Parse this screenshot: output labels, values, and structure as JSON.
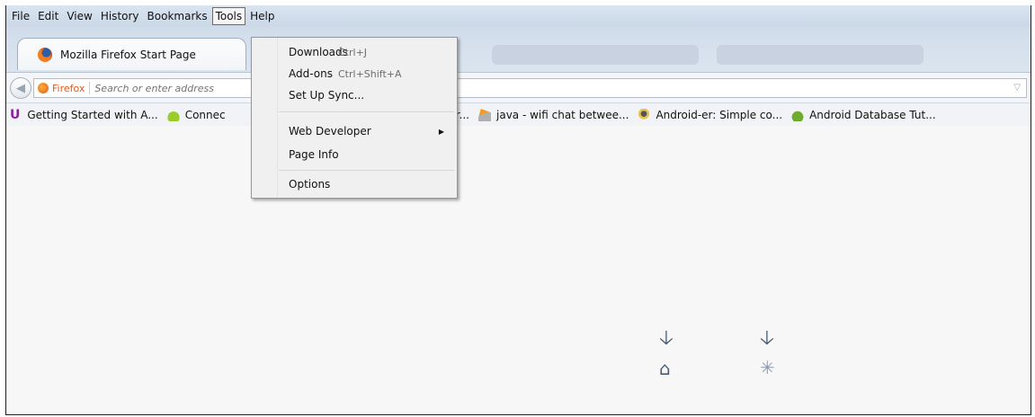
{
  "menubar": {
    "items": [
      {
        "label": "File"
      },
      {
        "label": "Edit"
      },
      {
        "label": "View"
      },
      {
        "label": "History"
      },
      {
        "label": "Bookmarks"
      },
      {
        "label": "Tools"
      },
      {
        "label": "Help"
      }
    ]
  },
  "tab": {
    "title": "Mozilla Firefox Start Page",
    "favicon": "firefox-icon"
  },
  "navbar": {
    "identity_label": "Firefox",
    "url_placeholder": "Search or enter address",
    "back_icon": "back-arrow-icon"
  },
  "bookmarks": [
    {
      "label": "Getting Started with A...",
      "icon": "u-icon"
    },
    {
      "label": "Connec",
      "icon": "android-icon"
    },
    {
      "label": "ed | Andr...",
      "icon": "none"
    },
    {
      "label": "java - wifi chat betwee...",
      "icon": "stackoverflow-icon"
    },
    {
      "label": "Android-er: Simple co...",
      "icon": "robot-icon"
    },
    {
      "label": "Android Database Tut...",
      "icon": "android-head-icon"
    }
  ],
  "tools_menu": {
    "downloads": {
      "label": "Downloads",
      "shortcut": "Ctrl+J"
    },
    "addons": {
      "label": "Add-ons",
      "shortcut": "Ctrl+Shift+A"
    },
    "sync": {
      "label": "Set Up Sync..."
    },
    "web_developer": {
      "label": "Web Developer"
    },
    "page_info": {
      "label": "Page Info"
    },
    "options": {
      "label": "Options"
    }
  },
  "content": {
    "icons": [
      "download-arrow-icon",
      "download-arrow-icon",
      "home-icon",
      "loading-spinner-icon"
    ]
  },
  "colors": {
    "accent": "#e0591a",
    "chrome": "#cbd8e7",
    "icon": "#4a5c75"
  }
}
